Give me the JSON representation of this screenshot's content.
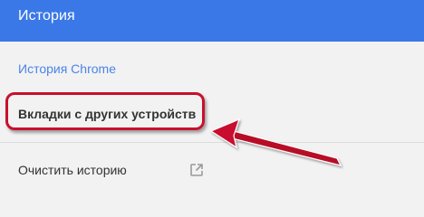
{
  "header": {
    "title": "История"
  },
  "nav": {
    "chrome_history": "История Chrome",
    "other_devices_tabs": "Вкладки с других устройств",
    "clear_history": "Очистить историю"
  },
  "icons": {
    "clear_history_icon": "open-in-new-icon"
  },
  "colors": {
    "header_bg": "#3b78e7",
    "active_link": "#4a84e8",
    "highlight": "#c8102e"
  }
}
